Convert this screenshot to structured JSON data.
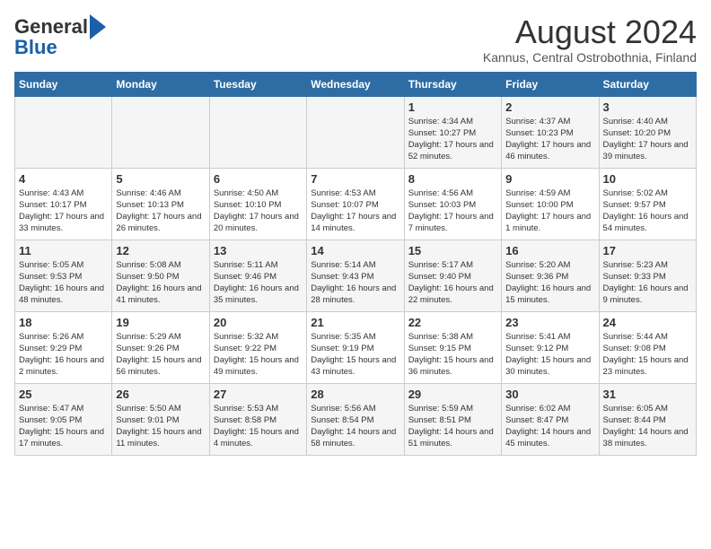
{
  "header": {
    "logo_general": "General",
    "logo_blue": "Blue",
    "title": "August 2024",
    "subtitle": "Kannus, Central Ostrobothnia, Finland"
  },
  "days_of_week": [
    "Sunday",
    "Monday",
    "Tuesday",
    "Wednesday",
    "Thursday",
    "Friday",
    "Saturday"
  ],
  "weeks": [
    [
      {
        "day": "",
        "info": ""
      },
      {
        "day": "",
        "info": ""
      },
      {
        "day": "",
        "info": ""
      },
      {
        "day": "",
        "info": ""
      },
      {
        "day": "1",
        "info": "Sunrise: 4:34 AM\nSunset: 10:27 PM\nDaylight: 17 hours\nand 52 minutes."
      },
      {
        "day": "2",
        "info": "Sunrise: 4:37 AM\nSunset: 10:23 PM\nDaylight: 17 hours\nand 46 minutes."
      },
      {
        "day": "3",
        "info": "Sunrise: 4:40 AM\nSunset: 10:20 PM\nDaylight: 17 hours\nand 39 minutes."
      }
    ],
    [
      {
        "day": "4",
        "info": "Sunrise: 4:43 AM\nSunset: 10:17 PM\nDaylight: 17 hours\nand 33 minutes."
      },
      {
        "day": "5",
        "info": "Sunrise: 4:46 AM\nSunset: 10:13 PM\nDaylight: 17 hours\nand 26 minutes."
      },
      {
        "day": "6",
        "info": "Sunrise: 4:50 AM\nSunset: 10:10 PM\nDaylight: 17 hours\nand 20 minutes."
      },
      {
        "day": "7",
        "info": "Sunrise: 4:53 AM\nSunset: 10:07 PM\nDaylight: 17 hours\nand 14 minutes."
      },
      {
        "day": "8",
        "info": "Sunrise: 4:56 AM\nSunset: 10:03 PM\nDaylight: 17 hours\nand 7 minutes."
      },
      {
        "day": "9",
        "info": "Sunrise: 4:59 AM\nSunset: 10:00 PM\nDaylight: 17 hours\nand 1 minute."
      },
      {
        "day": "10",
        "info": "Sunrise: 5:02 AM\nSunset: 9:57 PM\nDaylight: 16 hours\nand 54 minutes."
      }
    ],
    [
      {
        "day": "11",
        "info": "Sunrise: 5:05 AM\nSunset: 9:53 PM\nDaylight: 16 hours\nand 48 minutes."
      },
      {
        "day": "12",
        "info": "Sunrise: 5:08 AM\nSunset: 9:50 PM\nDaylight: 16 hours\nand 41 minutes."
      },
      {
        "day": "13",
        "info": "Sunrise: 5:11 AM\nSunset: 9:46 PM\nDaylight: 16 hours\nand 35 minutes."
      },
      {
        "day": "14",
        "info": "Sunrise: 5:14 AM\nSunset: 9:43 PM\nDaylight: 16 hours\nand 28 minutes."
      },
      {
        "day": "15",
        "info": "Sunrise: 5:17 AM\nSunset: 9:40 PM\nDaylight: 16 hours\nand 22 minutes."
      },
      {
        "day": "16",
        "info": "Sunrise: 5:20 AM\nSunset: 9:36 PM\nDaylight: 16 hours\nand 15 minutes."
      },
      {
        "day": "17",
        "info": "Sunrise: 5:23 AM\nSunset: 9:33 PM\nDaylight: 16 hours\nand 9 minutes."
      }
    ],
    [
      {
        "day": "18",
        "info": "Sunrise: 5:26 AM\nSunset: 9:29 PM\nDaylight: 16 hours\nand 2 minutes."
      },
      {
        "day": "19",
        "info": "Sunrise: 5:29 AM\nSunset: 9:26 PM\nDaylight: 15 hours\nand 56 minutes."
      },
      {
        "day": "20",
        "info": "Sunrise: 5:32 AM\nSunset: 9:22 PM\nDaylight: 15 hours\nand 49 minutes."
      },
      {
        "day": "21",
        "info": "Sunrise: 5:35 AM\nSunset: 9:19 PM\nDaylight: 15 hours\nand 43 minutes."
      },
      {
        "day": "22",
        "info": "Sunrise: 5:38 AM\nSunset: 9:15 PM\nDaylight: 15 hours\nand 36 minutes."
      },
      {
        "day": "23",
        "info": "Sunrise: 5:41 AM\nSunset: 9:12 PM\nDaylight: 15 hours\nand 30 minutes."
      },
      {
        "day": "24",
        "info": "Sunrise: 5:44 AM\nSunset: 9:08 PM\nDaylight: 15 hours\nand 23 minutes."
      }
    ],
    [
      {
        "day": "25",
        "info": "Sunrise: 5:47 AM\nSunset: 9:05 PM\nDaylight: 15 hours\nand 17 minutes."
      },
      {
        "day": "26",
        "info": "Sunrise: 5:50 AM\nSunset: 9:01 PM\nDaylight: 15 hours\nand 11 minutes."
      },
      {
        "day": "27",
        "info": "Sunrise: 5:53 AM\nSunset: 8:58 PM\nDaylight: 15 hours\nand 4 minutes."
      },
      {
        "day": "28",
        "info": "Sunrise: 5:56 AM\nSunset: 8:54 PM\nDaylight: 14 hours\nand 58 minutes."
      },
      {
        "day": "29",
        "info": "Sunrise: 5:59 AM\nSunset: 8:51 PM\nDaylight: 14 hours\nand 51 minutes."
      },
      {
        "day": "30",
        "info": "Sunrise: 6:02 AM\nSunset: 8:47 PM\nDaylight: 14 hours\nand 45 minutes."
      },
      {
        "day": "31",
        "info": "Sunrise: 6:05 AM\nSunset: 8:44 PM\nDaylight: 14 hours\nand 38 minutes."
      }
    ]
  ]
}
